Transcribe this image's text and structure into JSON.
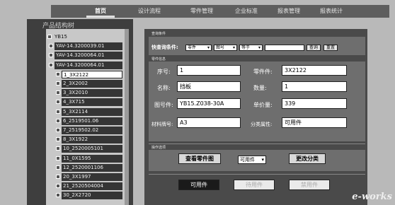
{
  "nav": {
    "tabs": [
      {
        "label": "首页",
        "active": true
      },
      {
        "label": "设计流程"
      },
      {
        "label": "零件管理"
      },
      {
        "label": "企业标准"
      },
      {
        "label": "报表管理"
      },
      {
        "label": "报表统计"
      }
    ]
  },
  "sidebar": {
    "title": "产品结构树",
    "items": [
      {
        "label": "YB15",
        "style": "light",
        "indent": 1
      },
      {
        "label": "YAV-14.3200039.01",
        "style": "dark",
        "indent": 2
      },
      {
        "label": "YAV-14.3200064.01",
        "style": "dark",
        "indent": 2
      },
      {
        "label": "YAV-14.3200064.01",
        "style": "dark",
        "indent": 2
      },
      {
        "label": "1_3X2122",
        "style": "selected",
        "indent": 3
      },
      {
        "label": "2_3X2002",
        "style": "dark",
        "indent": 3
      },
      {
        "label": "3_3X2010",
        "style": "dark",
        "indent": 3
      },
      {
        "label": "4_3X715",
        "style": "dark",
        "indent": 3
      },
      {
        "label": "5_3X2114",
        "style": "dark",
        "indent": 3
      },
      {
        "label": "6_2519501.06",
        "style": "dark",
        "indent": 3
      },
      {
        "label": "7_2519502.02",
        "style": "dark",
        "indent": 3
      },
      {
        "label": "8_3X1922",
        "style": "dark",
        "indent": 3
      },
      {
        "label": "10_2520005101",
        "style": "dark",
        "indent": 3
      },
      {
        "label": "11_0X1595",
        "style": "dark",
        "indent": 3
      },
      {
        "label": "12_2520001106",
        "style": "dark",
        "indent": 3
      },
      {
        "label": "20_3X1997",
        "style": "dark",
        "indent": 3
      },
      {
        "label": "21_2520504004",
        "style": "dark",
        "indent": 3
      },
      {
        "label": "30_2X2720",
        "style": "dark",
        "indent": 3
      }
    ]
  },
  "search": {
    "section_label": "查询条件",
    "label": "快查询条件:",
    "select1": "零件",
    "select2": "图号",
    "select3": "等于",
    "value": "",
    "query_button": "查询",
    "reset_button": "重置"
  },
  "detail": {
    "section_label": "零件信息",
    "fields": {
      "seq_label": "序号:",
      "seq_value": "1",
      "part_label": "零件件:",
      "part_value": "3X2122",
      "name_label": "名称:",
      "name_value": "挡板",
      "qty_label": "数量:",
      "qty_value": "1",
      "drawing_label": "图号件:",
      "drawing_value": "YB15.Z038-30A",
      "unitprice_label": "单价量:",
      "unitprice_value": "339",
      "material_label": "材料牌号:",
      "material_value": "A3",
      "category_label": "分类属性:",
      "category_value": "可用件"
    }
  },
  "actions": {
    "section_label": "操作选项",
    "view_drawing": "查看零件图",
    "category_select": "可用件",
    "change_category": "更改分类"
  },
  "bottom_tabs": {
    "tab1": "可用件",
    "tab2": "待用件",
    "tab3": "禁用件"
  },
  "watermark": "e-works"
}
